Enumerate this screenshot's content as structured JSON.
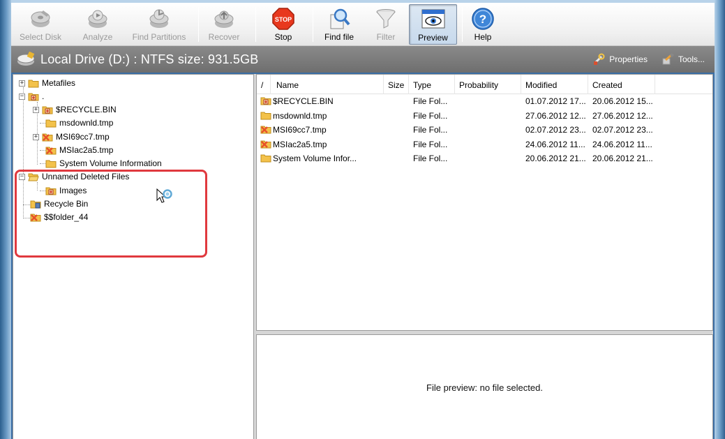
{
  "toolbar": {
    "buttons": [
      {
        "label": "Select Disk",
        "enabled": false
      },
      {
        "label": "Analyze",
        "enabled": false
      },
      {
        "label": "Find Partitions",
        "enabled": false
      },
      {
        "label": "Recover",
        "enabled": false
      },
      {
        "label": "Stop",
        "enabled": true,
        "icon_text": "STOP"
      },
      {
        "label": "Find file",
        "enabled": true
      },
      {
        "label": "Filter",
        "enabled": false
      },
      {
        "label": "Preview",
        "enabled": true,
        "pressed": true
      },
      {
        "label": "Help",
        "enabled": true,
        "icon_text": "?"
      }
    ]
  },
  "drive": {
    "title": "Local Drive (D:) : NTFS size: 931.5GB",
    "properties_label": "Properties",
    "tools_label": "Tools..."
  },
  "tree": {
    "items": [
      {
        "label": "Metafiles",
        "expander": "+"
      },
      {
        "label": ".",
        "expander": "−"
      },
      {
        "label": "$RECYCLE.BIN",
        "expander": "+"
      },
      {
        "label": "msdownld.tmp"
      },
      {
        "label": "MSI69cc7.tmp",
        "expander": "+"
      },
      {
        "label": "MSIac2a5.tmp"
      },
      {
        "label": "System Volume Information"
      },
      {
        "label": "Unnamed Deleted Files",
        "expander": "−"
      },
      {
        "label": "Images"
      },
      {
        "label": "Recycle Bin"
      },
      {
        "label": "$$folder_44"
      }
    ]
  },
  "list": {
    "sort_indicator": "/",
    "columns": [
      "Name",
      "Size",
      "Type",
      "Probability",
      "Modified",
      "Created"
    ],
    "rows": [
      {
        "name": "$RECYCLE.BIN",
        "size": "",
        "type": "File Fol...",
        "probability": "",
        "modified": "01.07.2012 17...",
        "created": "20.06.2012 15..."
      },
      {
        "name": "msdownld.tmp",
        "size": "",
        "type": "File Fol...",
        "probability": "",
        "modified": "27.06.2012 12...",
        "created": "27.06.2012 12..."
      },
      {
        "name": "MSI69cc7.tmp",
        "size": "",
        "type": "File Fol...",
        "probability": "",
        "modified": "02.07.2012 23...",
        "created": "02.07.2012 23..."
      },
      {
        "name": "MSIac2a5.tmp",
        "size": "",
        "type": "File Fol...",
        "probability": "",
        "modified": "24.06.2012 11...",
        "created": "24.06.2012 11..."
      },
      {
        "name": "System Volume Infor...",
        "size": "",
        "type": "File Fol...",
        "probability": "",
        "modified": "20.06.2012 21...",
        "created": "20.06.2012 21..."
      }
    ]
  },
  "preview": {
    "message": "File preview: no file selected."
  },
  "colors": {
    "highlight": "#e0393e",
    "folder": "#f3c24b",
    "deleted_folder": "#e8512a"
  }
}
